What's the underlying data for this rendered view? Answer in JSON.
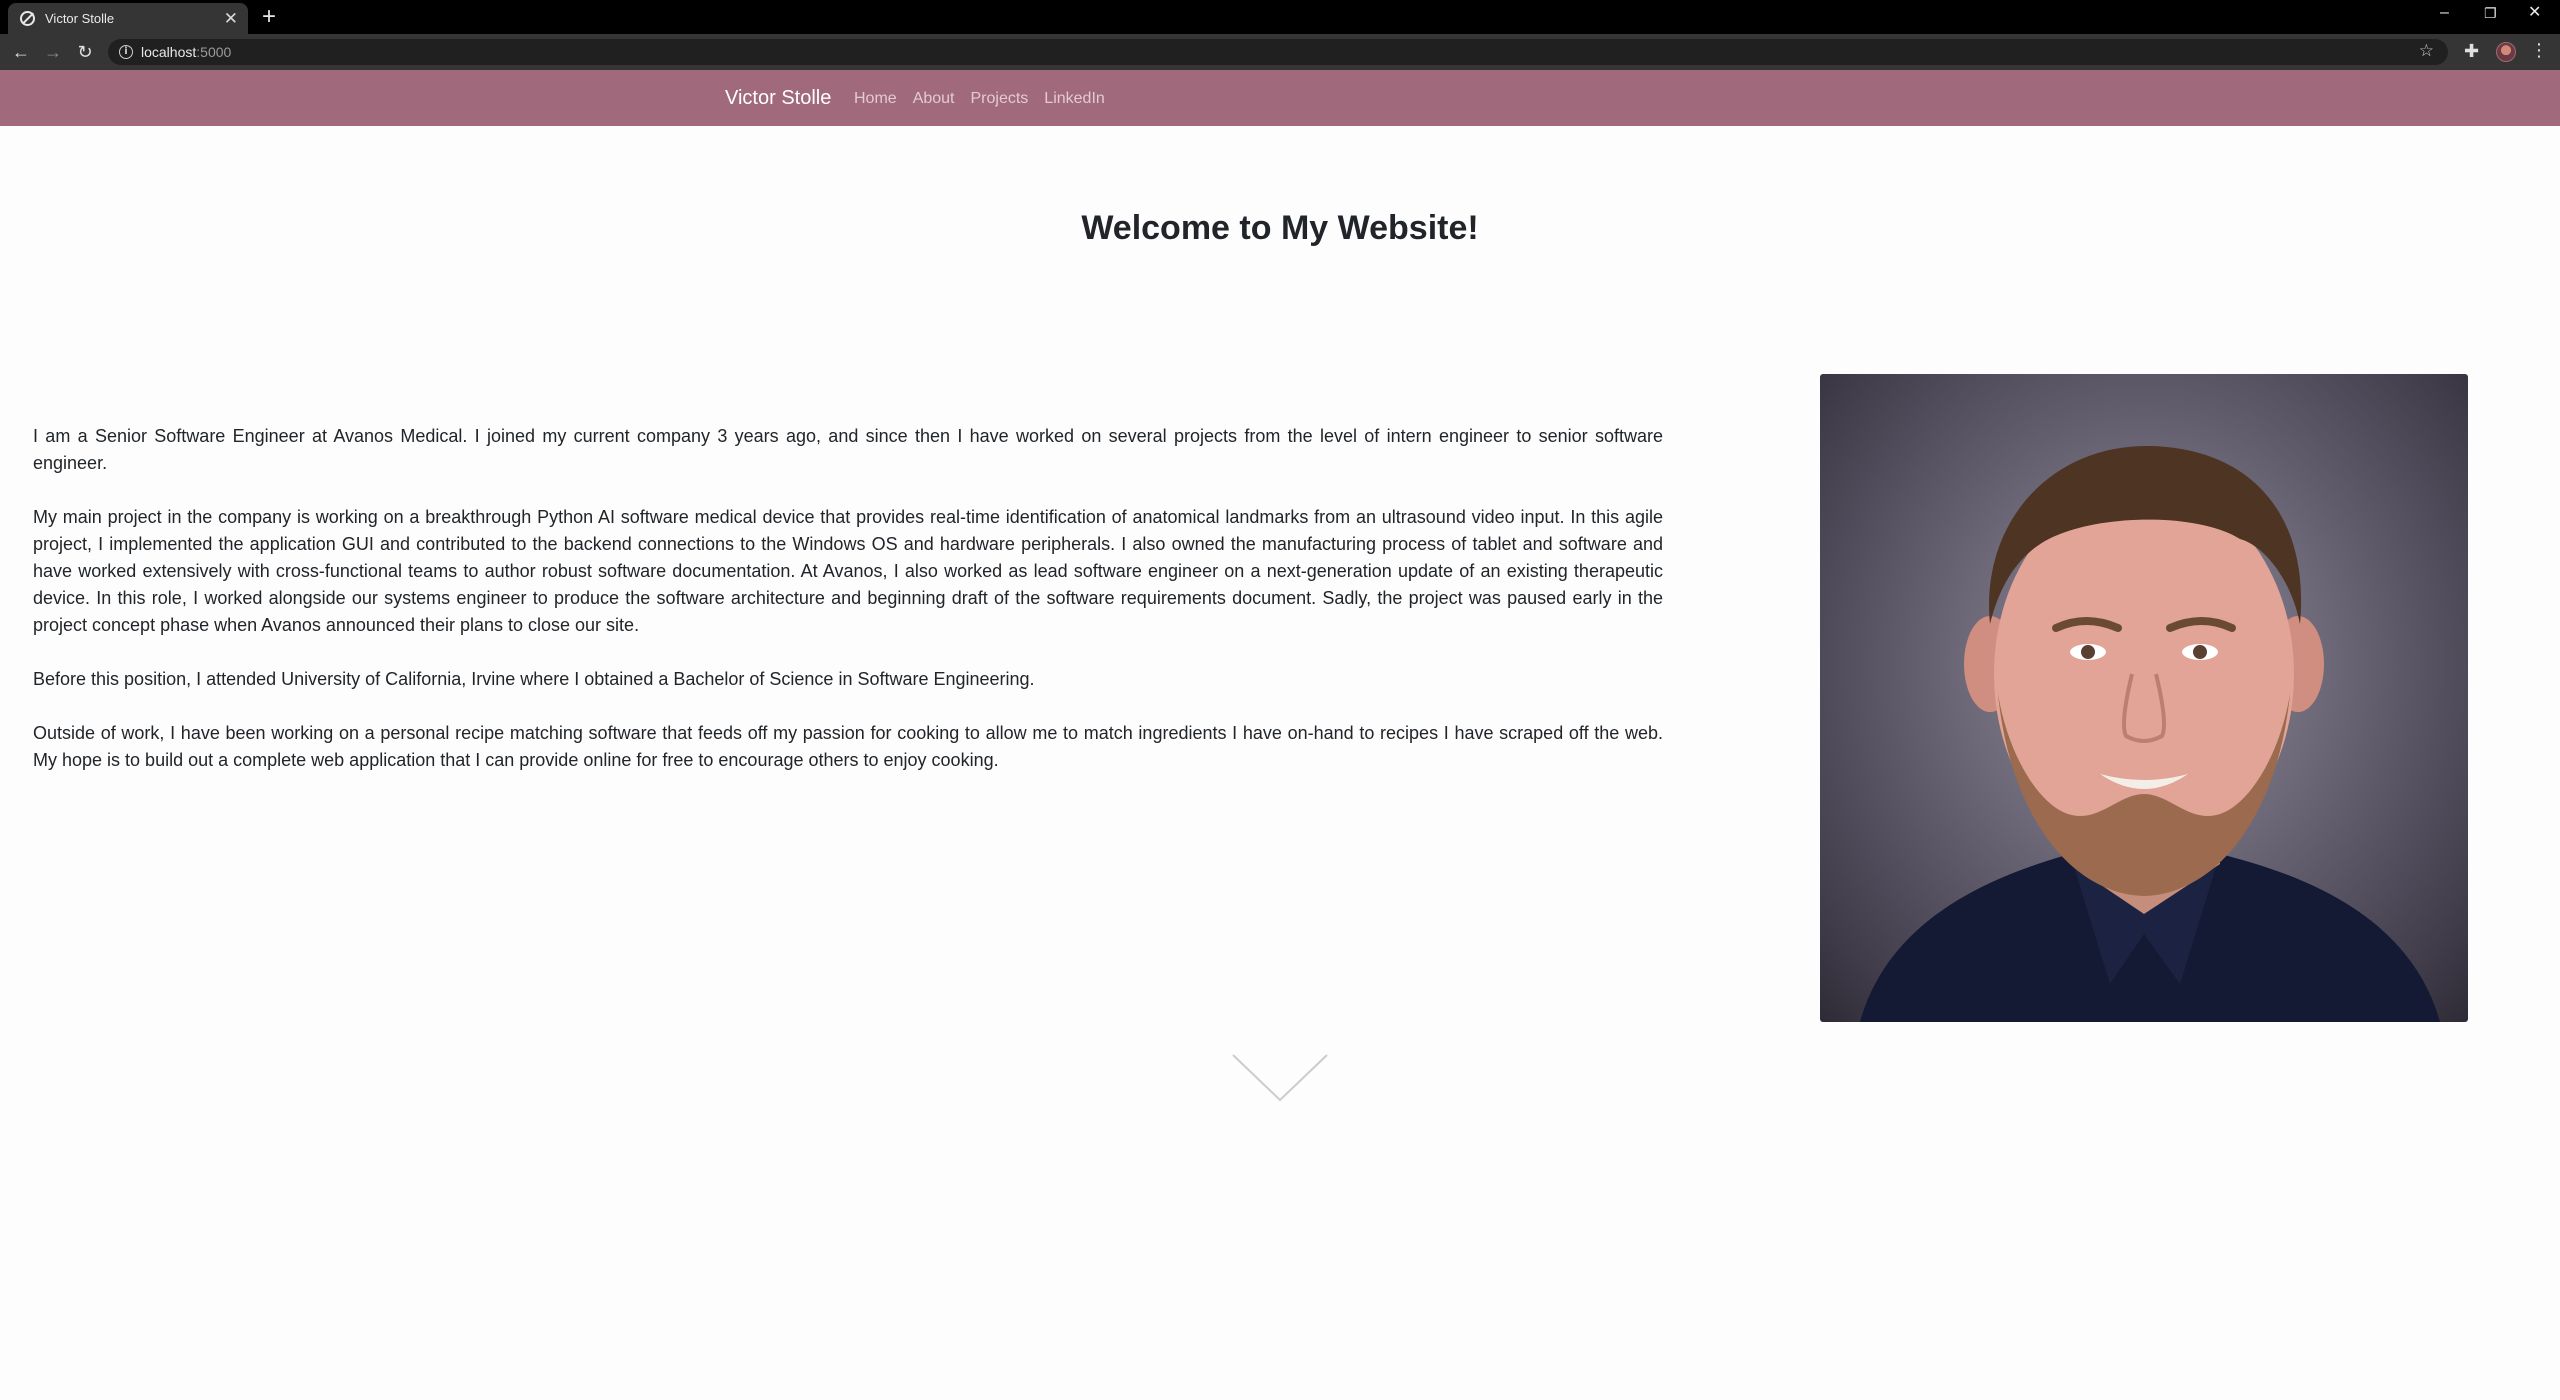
{
  "browser": {
    "tab_title": "Victor Stolle",
    "url_host": "localhost",
    "url_port": ":5000"
  },
  "navbar": {
    "brand": "Victor Stolle",
    "links": [
      "Home",
      "About",
      "Projects",
      "LinkedIn"
    ]
  },
  "main": {
    "title": "Welcome to My Website!",
    "paragraphs": [
      "I am a Senior Software Engineer at Avanos Medical. I joined my current company 3 years ago, and since then I have worked on several projects from the level of intern engineer to senior software engineer.",
      "My main project in the company is working on a breakthrough Python AI software medical device that provides real-time identification of anatomical landmarks from an ultrasound video input. In this agile project, I implemented the application GUI and contributed to the backend connections to the Windows OS and hardware peripherals. I also owned the manufacturing process of tablet and software and have worked extensively with cross-functional teams to author robust software documentation. At Avanos, I also worked as lead software engineer on a next-generation update of an existing therapeutic device. In this role, I worked alongside our systems engineer to produce the software architecture and beginning draft of the software requirements document. Sadly, the project was paused early in the project concept phase when Avanos announced their plans to close our site.",
      "Before this position, I attended University of California, Irvine where I obtained a Bachelor of Science in Software Engineering.",
      "Outside of work, I have been working on a personal recipe matching software that feeds off my passion for cooking to allow me to match ingredients I have on-hand to recipes I have scraped off the web. My hope is to build out a complete web application that I can provide online for free to encourage others to enjoy cooking."
    ]
  },
  "colors": {
    "navbar_bg": "#a0697c",
    "page_bg": "#fdfdfd",
    "text": "#212529"
  },
  "icons": [
    "globe-favicon-icon",
    "close-icon",
    "plus-icon",
    "back-arrow-icon",
    "forward-arrow-icon",
    "reload-icon",
    "info-icon",
    "star-icon",
    "puzzle-icon",
    "kebab-menu-icon",
    "chevron-down-icon"
  ]
}
